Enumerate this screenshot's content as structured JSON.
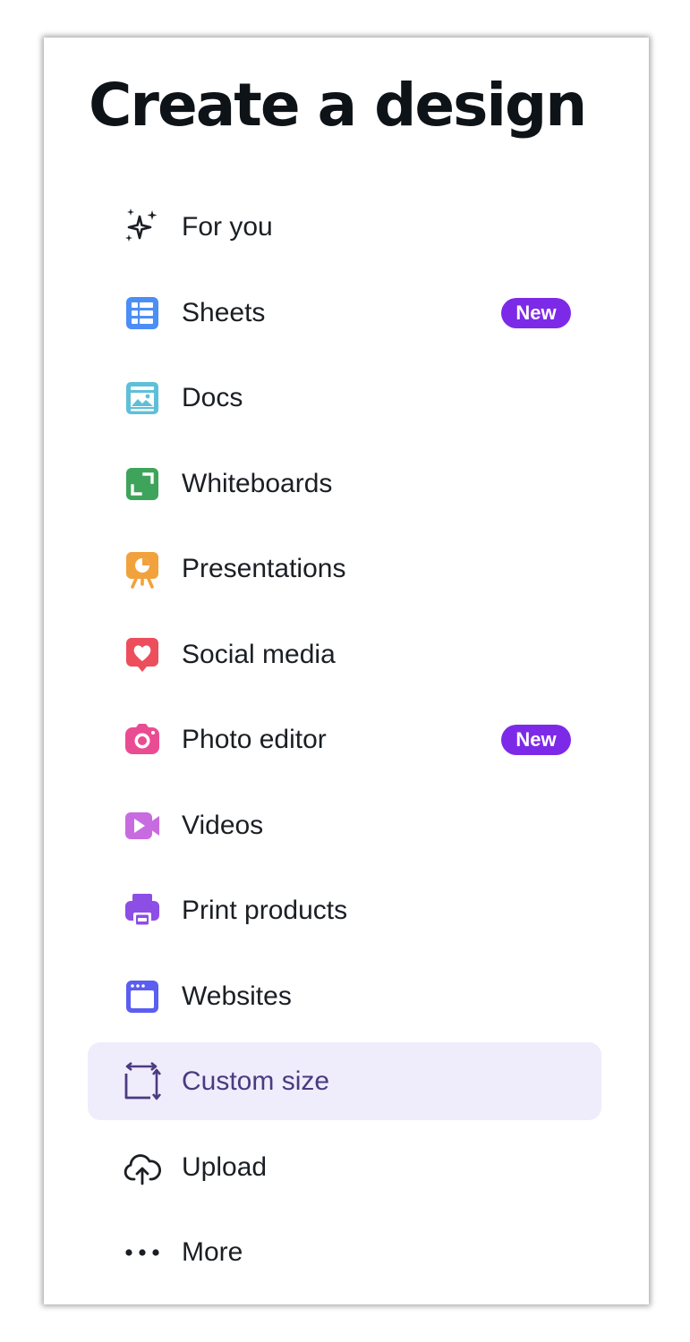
{
  "panel": {
    "title": "Create a design",
    "items": [
      {
        "label": "For you",
        "icon": "sparkles-icon"
      },
      {
        "label": "Sheets",
        "icon": "sheets-grid-icon",
        "badge": "New"
      },
      {
        "label": "Docs",
        "icon": "docs-icon"
      },
      {
        "label": "Whiteboards",
        "icon": "whiteboard-icon"
      },
      {
        "label": "Presentations",
        "icon": "presentation-easel-icon"
      },
      {
        "label": "Social media",
        "icon": "heart-bubble-icon"
      },
      {
        "label": "Photo editor",
        "icon": "camera-icon",
        "badge": "New"
      },
      {
        "label": "Videos",
        "icon": "video-camera-icon"
      },
      {
        "label": "Print products",
        "icon": "printer-icon"
      },
      {
        "label": "Websites",
        "icon": "browser-window-icon"
      },
      {
        "label": "Custom size",
        "icon": "resize-frame-icon",
        "selected": true
      },
      {
        "label": "Upload",
        "icon": "cloud-upload-icon"
      },
      {
        "label": "More",
        "icon": "more-dots-icon"
      }
    ]
  },
  "colors": {
    "badge": "#7d2ae8",
    "selected_bg": "#efedfc",
    "selected_text": "#4b3a80",
    "sheets": "#4c8ef7",
    "docs": "#5ec0d8",
    "whiteboards": "#3fa45b",
    "presentations": "#f2a23c",
    "social": "#ec4e5c",
    "photo": "#ea4c93",
    "videos": "#c96be0",
    "print": "#8d4ee6",
    "websites": "#5b5ef0"
  }
}
